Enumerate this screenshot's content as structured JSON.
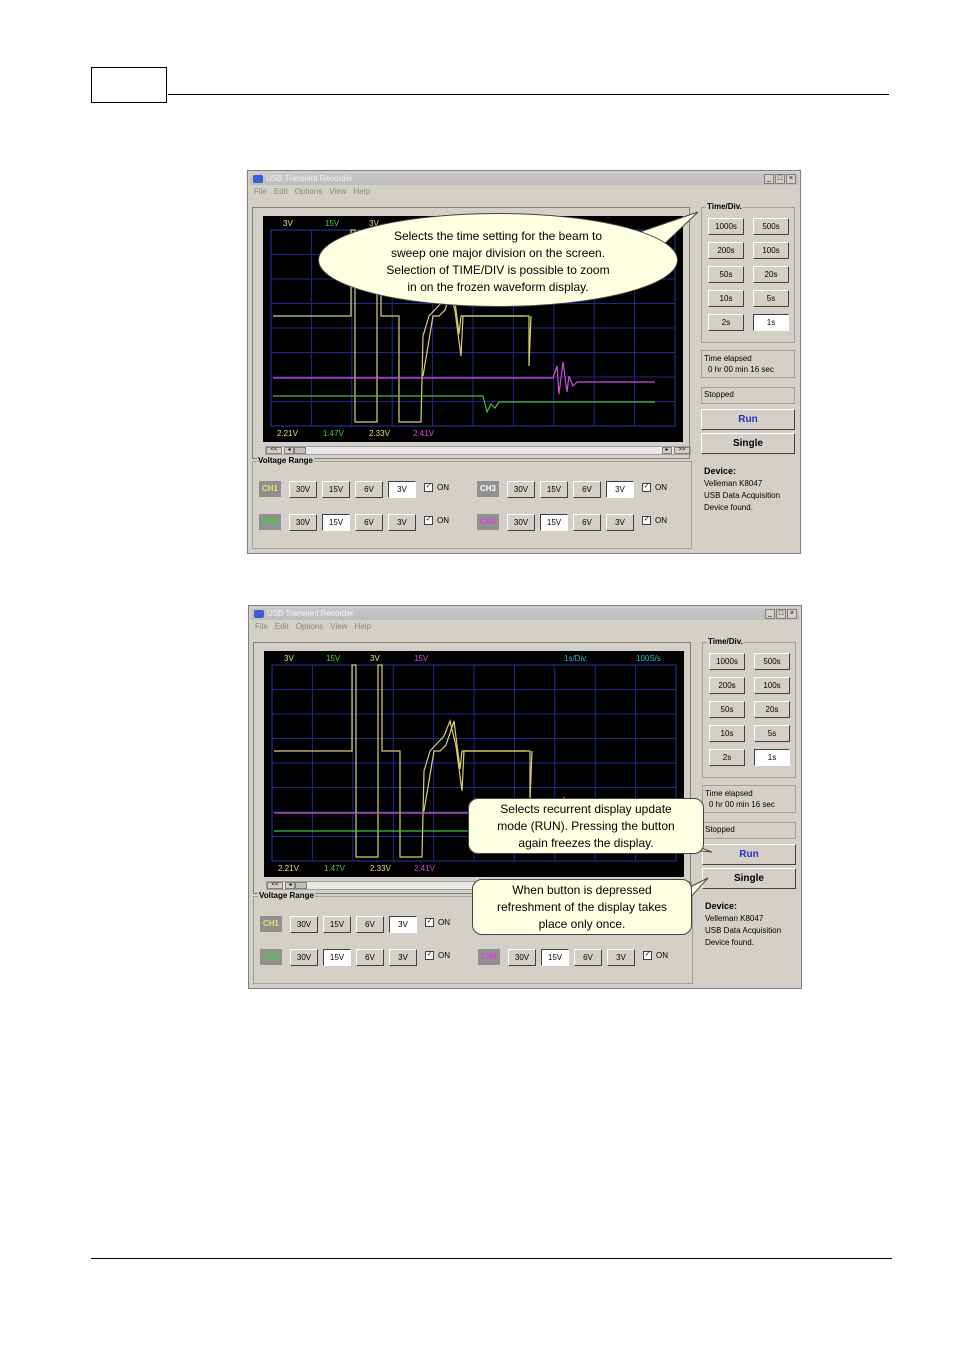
{
  "app": {
    "title": "USB Transient Recorder",
    "menu": [
      "File",
      "Edit",
      "Options",
      "View",
      "Help"
    ],
    "win_buttons": [
      "_",
      "□",
      "×"
    ]
  },
  "timediv": {
    "title": "Time/Div.",
    "buttons": [
      "1000s",
      "500s",
      "200s",
      "100s",
      "50s",
      "20s",
      "10s",
      "5s",
      "2s",
      "1s"
    ],
    "selected": "1s"
  },
  "elapsed": {
    "label": "Time elapsed",
    "value": "0 hr  00 min  16 sec"
  },
  "status": "Stopped",
  "run_label": "Run",
  "single_label": "Single",
  "device": {
    "title": "Device:",
    "lines": [
      "Velleman  K8047",
      "USB Data Acquisition",
      "Device found."
    ]
  },
  "voltage": {
    "title": "Voltage Range",
    "ranges": [
      "30V",
      "15V",
      "6V",
      "3V"
    ],
    "on_label": "ON",
    "channels": [
      {
        "name": "CH1",
        "color": "#e8e070",
        "selected": "3V"
      },
      {
        "name": "CH2",
        "color": "#40d040",
        "selected": "15V"
      },
      {
        "name": "CH3",
        "color": "#ffffff",
        "selected": "3V"
      },
      {
        "name": "CH4",
        "color": "#e040e0",
        "selected": "15V"
      }
    ]
  },
  "scope": {
    "top_labels": [
      {
        "text": "3V",
        "color": "#e8e070"
      },
      {
        "text": "15V",
        "color": "#40d040"
      },
      {
        "text": "3V",
        "color": "#e8e070"
      },
      {
        "text": "15V",
        "color": "#e040e0"
      }
    ],
    "timebase": "1s/Div.",
    "samplerate": "100S/s",
    "bottom_labels": [
      {
        "text": "2.21V",
        "color": "#e8e070"
      },
      {
        "text": "1.47V",
        "color": "#40d040"
      },
      {
        "text": "2.33V",
        "color": "#e8e070"
      },
      {
        "text": "2.41V",
        "color": "#e040e0"
      }
    ],
    "scroll_left": "<<",
    "scroll_right": ">>"
  },
  "callouts": {
    "timediv": [
      "Selects the time setting for the beam to",
      "sweep one major division on the screen.",
      "Selection of TIME/DIV is possible to zoom",
      "in on the frozen waveform display."
    ],
    "run": [
      "Selects recurrent display update",
      "mode (RUN). Pressing the button",
      "again freezes the display."
    ],
    "single": [
      "When button is depressed",
      "refreshment of the display takes",
      "place only once."
    ]
  }
}
